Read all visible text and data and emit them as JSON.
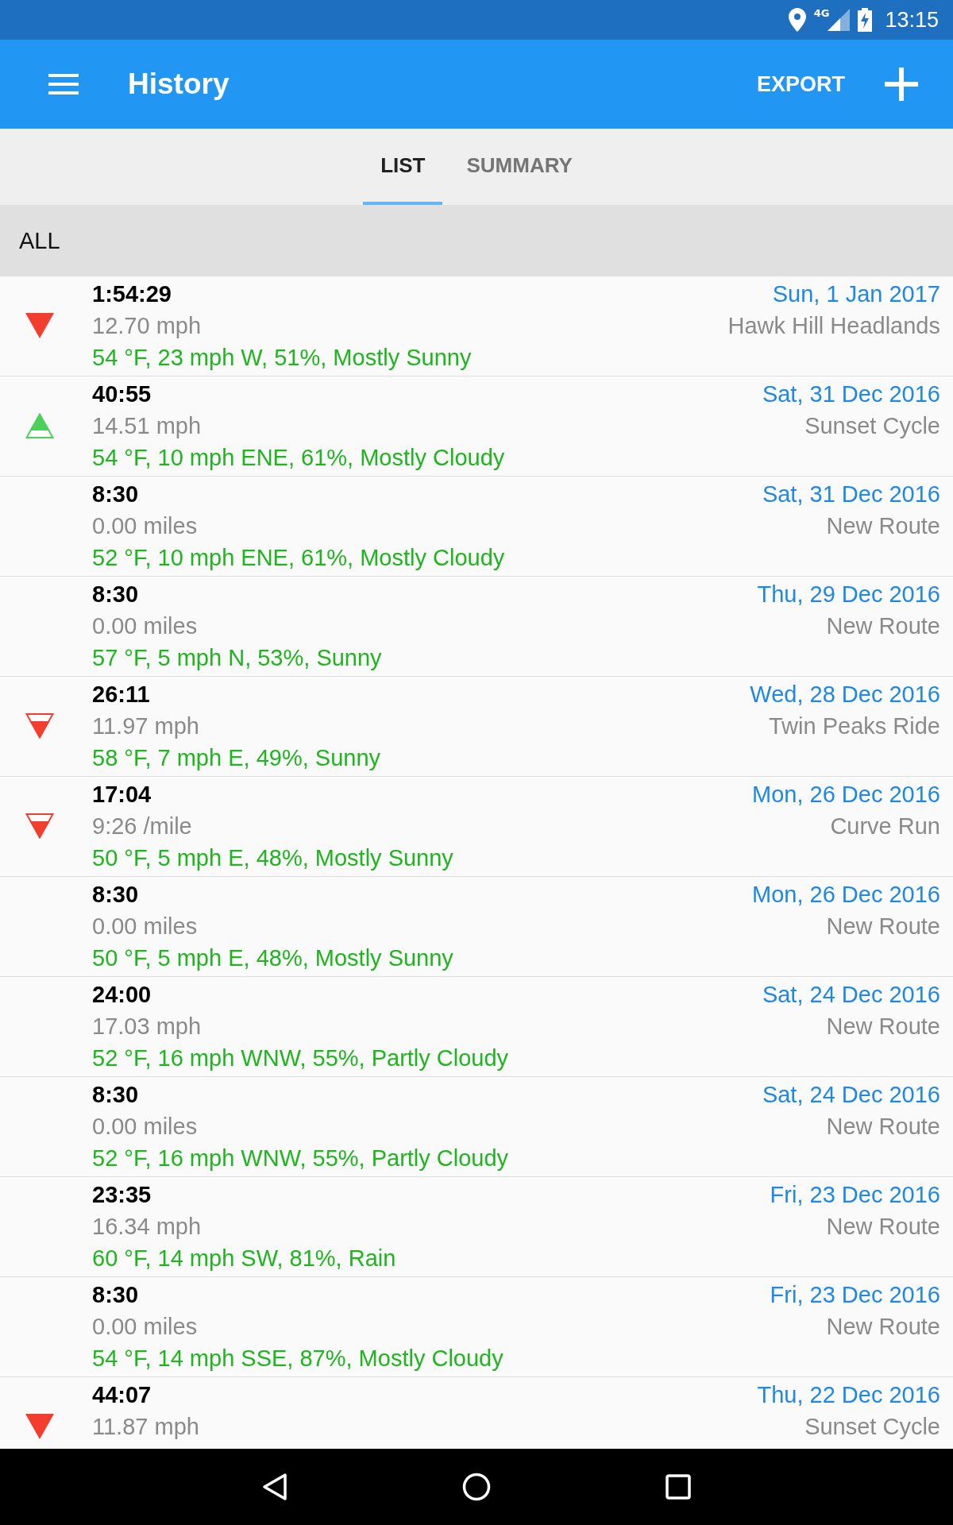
{
  "status_bar": {
    "network": "4G",
    "time": "13:15"
  },
  "app_bar": {
    "title": "History",
    "action": "EXPORT"
  },
  "tabs": [
    {
      "label": "LIST",
      "selected": true
    },
    {
      "label": "SUMMARY",
      "selected": false
    }
  ],
  "filter": "ALL",
  "rows": [
    {
      "kind": "down-solid",
      "duration": "1:54:29",
      "pace": "12.70 mph",
      "weather": "54 °F, 23 mph W, 51%, Mostly Sunny",
      "date": "Sun, 1 Jan 2017",
      "route": "Hawk Hill Headlands"
    },
    {
      "kind": "up-partial",
      "duration": "40:55",
      "pace": "14.51 mph",
      "weather": "54 °F, 10 mph ENE, 61%, Mostly Cloudy",
      "date": "Sat, 31 Dec 2016",
      "route": "Sunset Cycle"
    },
    {
      "kind": "none",
      "duration": "8:30",
      "pace": "0.00 miles",
      "weather": "52 °F, 10 mph ENE, 61%, Mostly Cloudy",
      "date": "Sat, 31 Dec 2016",
      "route": "New Route"
    },
    {
      "kind": "none",
      "duration": "8:30",
      "pace": "0.00 miles",
      "weather": "57 °F, 5 mph N, 53%, Sunny",
      "date": "Thu, 29 Dec 2016",
      "route": "New Route"
    },
    {
      "kind": "down-partial",
      "duration": "26:11",
      "pace": "11.97 mph",
      "weather": "58 °F, 7 mph E, 49%, Sunny",
      "date": "Wed, 28 Dec 2016",
      "route": "Twin Peaks Ride"
    },
    {
      "kind": "down-partial",
      "duration": "17:04",
      "pace": "9:26 /mile",
      "weather": "50 °F, 5 mph E, 48%, Mostly Sunny",
      "date": "Mon, 26 Dec 2016",
      "route": "Curve Run"
    },
    {
      "kind": "none",
      "duration": "8:30",
      "pace": "0.00 miles",
      "weather": "50 °F, 5 mph E, 48%, Mostly Sunny",
      "date": "Mon, 26 Dec 2016",
      "route": "New Route"
    },
    {
      "kind": "none",
      "duration": "24:00",
      "pace": "17.03 mph",
      "weather": "52 °F, 16 mph WNW, 55%, Partly Cloudy",
      "date": "Sat, 24 Dec 2016",
      "route": "New Route"
    },
    {
      "kind": "none",
      "duration": "8:30",
      "pace": "0.00 miles",
      "weather": "52 °F, 16 mph WNW, 55%, Partly Cloudy",
      "date": "Sat, 24 Dec 2016",
      "route": "New Route"
    },
    {
      "kind": "none",
      "duration": "23:35",
      "pace": "16.34 mph",
      "weather": "60 °F, 14 mph SW, 81%, Rain",
      "date": "Fri, 23 Dec 2016",
      "route": "New Route"
    },
    {
      "kind": "none",
      "duration": "8:30",
      "pace": "0.00 miles",
      "weather": "54 °F, 14 mph SSE, 87%, Mostly Cloudy",
      "date": "Fri, 23 Dec 2016",
      "route": "New Route"
    },
    {
      "kind": "down-solid",
      "duration": "44:07",
      "pace": "11.87 mph",
      "date": "Thu, 22 Dec 2016",
      "route": "Sunset Cycle"
    }
  ]
}
